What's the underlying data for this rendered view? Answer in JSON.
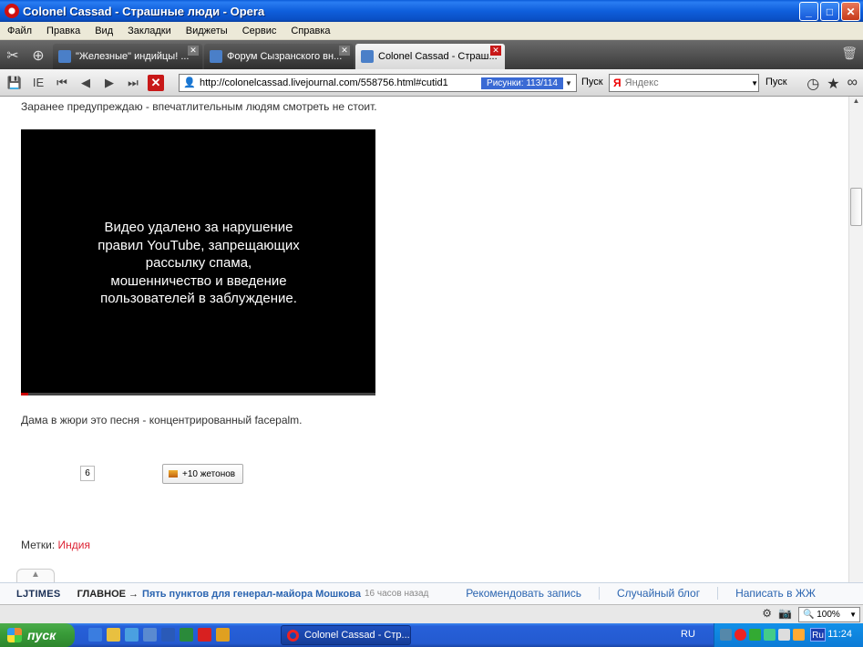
{
  "window": {
    "title": "Colonel Cassad - Страшные люди - Opera",
    "buttons": {
      "minimize": "_",
      "maximize": "□",
      "close": "✕"
    }
  },
  "menu": [
    "Файл",
    "Правка",
    "Вид",
    "Закладки",
    "Виджеты",
    "Сервис",
    "Справка"
  ],
  "tabs": [
    {
      "label": "\"Железные\" индийцы! ...",
      "active": false
    },
    {
      "label": "Форум Сызранского вн...",
      "active": false
    },
    {
      "label": "Colonel Cassad - Страш...",
      "active": true
    }
  ],
  "toolbar": {
    "ie_label": "IE",
    "url": "http://colonelcassad.livejournal.com/558756.html#cutid1",
    "pictures_label": "Рисунки:   113/114",
    "go_label": "Пуск",
    "search_placeholder": "Яндекс",
    "search_go_label": "Пуск"
  },
  "content": {
    "intro": "Заранее предупреждаю - впечатлительным людям смотреть не стоит.",
    "video_message": "Видео удалено за нарушение правил YouTube, запрещающих рассылку спама, мошенничество и введение пользователей в заблуждение.",
    "comment": "Дама в жюри это песня - концентрированный facepalm.",
    "like_count": "6",
    "tokens_button": "+10 жетонов",
    "tags_label": "Метки:",
    "tag": "Индия"
  },
  "ljtimes": {
    "logo": "LJTIMES",
    "main_label": "ГЛАВНОЕ →",
    "headline": "Пять пунктов для генерал-майора Мошкова",
    "time": "16 часов назад",
    "links": [
      "Рекомендовать запись",
      "Случайный блог",
      "Написать в ЖЖ"
    ]
  },
  "statusbar": {
    "zoom": "100%"
  },
  "taskbar": {
    "start_label": "пуск",
    "active_task": "Colonel Cassad - Стр...",
    "language": "RU",
    "tray_lang": "Ru",
    "clock": "11:24"
  }
}
